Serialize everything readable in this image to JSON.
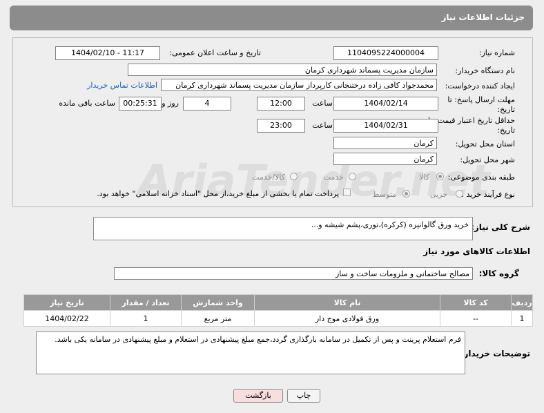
{
  "header": {
    "title": "جزئیات اطلاعات نیاز"
  },
  "form": {
    "need_number_label": "شماره نیاز:",
    "need_number": "1104095224000004",
    "announce_label": "تاریخ و ساعت اعلان عمومی:",
    "announce_value": "1404/02/10 - 11:17",
    "buyer_org_label": "نام دستگاه خریدار:",
    "buyer_org": "سازمان مدیریت پسماند شهرداری کرمان",
    "creator_label": "ایجاد کننده درخواست:",
    "creator": "محمدجواد کافی زاده درختنجانی کارپرداز سازمان مدیریت پسماند شهرداری کرمان",
    "contact_link": "اطلاعات تماس خریدار",
    "reply_deadline_label": "مهلت ارسال پاسخ: تا تاریخ:",
    "reply_date": "1404/02/14",
    "time_label": "ساعت",
    "reply_time": "12:00",
    "days_value": "4",
    "days_label": "روز و",
    "remaining_time": "00:25:31",
    "remaining_label": "ساعت باقی مانده",
    "price_validity_label": "حداقل تاریخ اعتبار قیمت: تا تاریخ:",
    "price_date": "1404/02/31",
    "price_time": "23:00",
    "province_label": "استان محل تحویل:",
    "province": "کرمان",
    "city_label": "شهر محل تحویل:",
    "city": "کرمان",
    "category_label": "طبقه بندی موضوعی:",
    "category_options": [
      "کالا",
      "خدمت",
      "کالا/خدمت"
    ],
    "process_label": "نوع فرآیند خرید :",
    "process_options": [
      "جزیی",
      "متوسط"
    ],
    "payment_note": "پرداخت تمام یا بخشی از مبلغ خرید،از محل \"اسناد خزانه اسلامی\" خواهد بود."
  },
  "description": {
    "label": "شرح کلی نیاز:",
    "text": "خرید ورق گالوانیزه (کرکره)،توری،پشم شیشه و..."
  },
  "goods": {
    "section_title": "اطلاعات کالاهای مورد نیاز",
    "group_label": "گروه کالا:",
    "group_value": "مصالح ساختمانی و ملزومات ساخت و ساز",
    "columns": [
      "ردیف",
      "کد کالا",
      "نام کالا",
      "واحد شمارش",
      "تعداد / مقدار",
      "تاریخ نیاز"
    ],
    "rows": [
      [
        "1",
        "--",
        "ورق فولادی موج دار",
        "متر مربع",
        "1",
        "1404/02/22"
      ]
    ]
  },
  "buyer_notes": {
    "label": "توضیحات خریدار:",
    "text": "فرم استعلام پرینت و پس از تکمیل در سامانه بارگذاری گردد،جمع مبلغ پیشنهادی در استعلام و مبلغ پیشنهادی در سامانه یکی باشد."
  },
  "buttons": {
    "print": "چاپ",
    "back": "بازگشت"
  },
  "watermark": "AriaTender.net",
  "colors": {
    "title_bar": "#8c8c8c",
    "table_header": "#999999",
    "link": "#1a5fb4",
    "back_button": "#f8dede"
  }
}
